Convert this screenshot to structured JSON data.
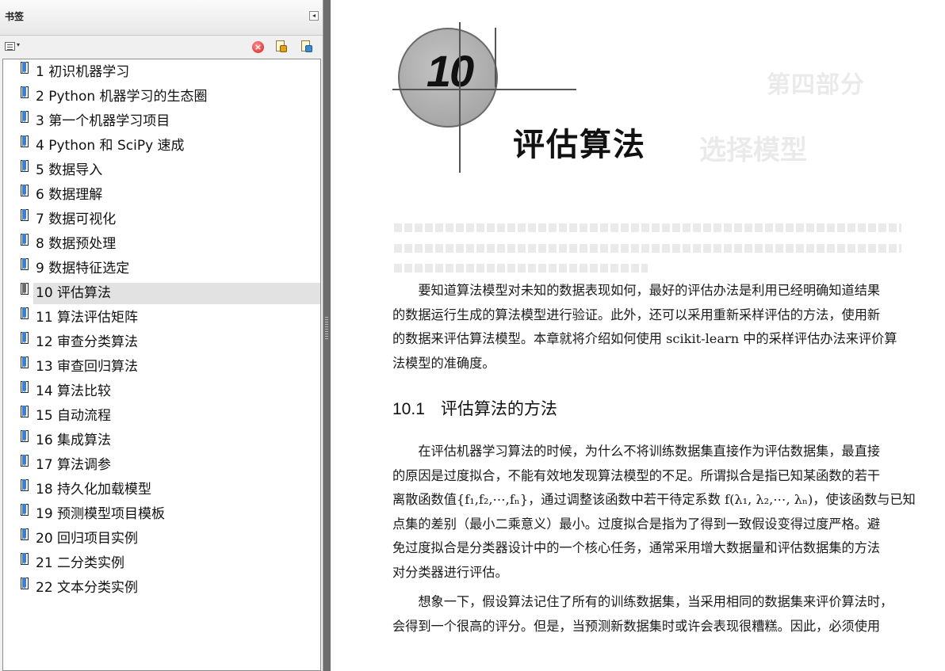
{
  "panel": {
    "title": "书签",
    "collapse_glyph": "◂"
  },
  "toolbar": {
    "options_caret": "▾",
    "delete_glyph": "×",
    "icons": [
      "options-menu-icon",
      "delete-bookmark-icon",
      "expand-bookmark-icon",
      "new-bookmark-icon"
    ]
  },
  "bookmarks": [
    {
      "label": "1 初识机器学习",
      "selected": false
    },
    {
      "label": "2 Python 机器学习的生态圈",
      "selected": false
    },
    {
      "label": "3 第一个机器学习项目",
      "selected": false
    },
    {
      "label": "4 Python 和 SciPy 速成",
      "selected": false
    },
    {
      "label": "5 数据导入",
      "selected": false
    },
    {
      "label": "6 数据理解",
      "selected": false
    },
    {
      "label": "7 数据可视化",
      "selected": false
    },
    {
      "label": "8 数据预处理",
      "selected": false
    },
    {
      "label": "9 数据特征选定",
      "selected": false
    },
    {
      "label": "10 评估算法",
      "selected": true
    },
    {
      "label": "11 算法评估矩阵",
      "selected": false
    },
    {
      "label": "12 审查分类算法",
      "selected": false
    },
    {
      "label": "13 审查回归算法",
      "selected": false
    },
    {
      "label": "14 算法比较",
      "selected": false
    },
    {
      "label": "15 自动流程",
      "selected": false
    },
    {
      "label": "16 集成算法",
      "selected": false
    },
    {
      "label": "17 算法调参",
      "selected": false
    },
    {
      "label": "18 持久化加载模型",
      "selected": false
    },
    {
      "label": "19 预测模型项目模板",
      "selected": false
    },
    {
      "label": "20 回归项目实例",
      "selected": false
    },
    {
      "label": "21 二分类实例",
      "selected": false
    },
    {
      "label": "22 文本分类实例",
      "selected": false
    }
  ],
  "doc": {
    "chapter_number": "10",
    "chapter_title": "评估算法",
    "ghost_part": "第四部分",
    "ghost_title": "选择模型",
    "para1": [
      "　　要知道算法模型对未知的数据表现如何，最好的评估办法是利用已经明确知道结果",
      "的数据运行生成的算法模型进行验证。此外，还可以采用重新采样评估的方法，使用新",
      "的数据来评估算法模型。本章就将介绍如何使用 scikit-learn 中的采样评估办法来评价算",
      "法模型的准确度。"
    ],
    "section_number": "10.1",
    "section_title": "评估算法的方法",
    "para2": [
      "　　在评估机器学习算法的时候，为什么不将训练数据集直接作为评估数据集，最直接",
      "的原因是过度拟合，不能有效地发现算法模型的不足。所谓拟合是指已知某函数的若干",
      "离散函数值{f₁,f₂,⋯,fₙ}，通过调整该函数中若干待定系数 f(λ₁, λ₂,⋯, λₙ)，使该函数与已知",
      "点集的差别（最小二乘意义）最小。过度拟合是指为了得到一致假设变得过度严格。避",
      "免过度拟合是分类器设计中的一个核心任务，通常采用增大数据量和评估数据集的方法",
      "对分类器进行评估。"
    ],
    "para3": [
      "　　想象一下，假设算法记住了所有的训练数据集，当采用相同的数据集来评价算法时，",
      "会得到一个很高的评分。但是，当预测新数据集时或许会表现很糟糕。因此，必须使用"
    ]
  }
}
